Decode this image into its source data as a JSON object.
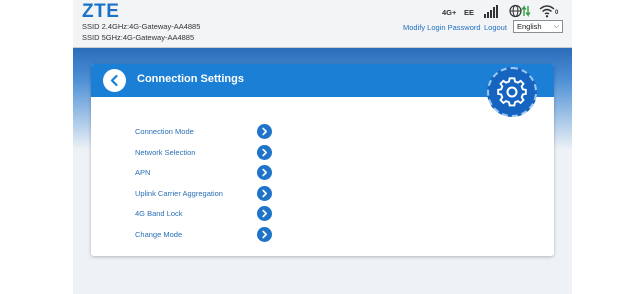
{
  "header": {
    "logo": "ZTE",
    "ssid_24": "SSID 2.4GHz:4G-Gateway-AA4885",
    "ssid_5": "SSID 5GHz:4G-Gateway-AA4885",
    "network_type": "4G+",
    "carrier": "EE",
    "wifi_clients": "0",
    "modify_password_label": "Modify Login Password",
    "logout_label": "Logout",
    "language_selected": "English"
  },
  "page": {
    "title": "Connection Settings"
  },
  "menu": {
    "items": [
      {
        "label": "Connection Mode"
      },
      {
        "label": "Network Selection"
      },
      {
        "label": "APN"
      },
      {
        "label": "Uplink Carrier Aggregation"
      },
      {
        "label": "4G Band Lock"
      },
      {
        "label": "Change Mode"
      }
    ]
  },
  "colors": {
    "brand_blue": "#1a73c7",
    "header_blue": "#1b7fd6",
    "link_blue": "#2a6fb5",
    "signal_green": "#2e9e3e"
  }
}
